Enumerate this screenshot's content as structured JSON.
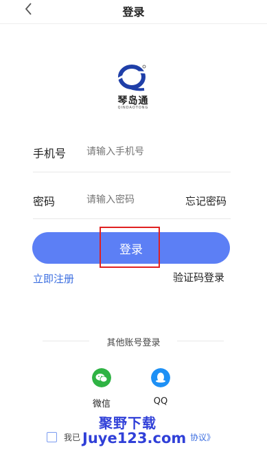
{
  "header": {
    "title": "登录",
    "back_icon": "chevron-left-icon"
  },
  "logo": {
    "name": "琴岛通",
    "subtitle": "QINDAOTONG"
  },
  "form": {
    "phone": {
      "label": "手机号",
      "placeholder": "请输入手机号"
    },
    "password": {
      "label": "密码",
      "placeholder": "请输入密码",
      "forgot_label": "忘记密码"
    }
  },
  "actions": {
    "login_label": "登录",
    "register_label": "立即注册",
    "code_login_label": "验证码登录"
  },
  "other_login": {
    "title": "其他账号登录",
    "options": [
      {
        "label": "微信",
        "icon": "wechat-icon",
        "color": "#2fb344"
      },
      {
        "label": "QQ",
        "icon": "qq-icon",
        "color": "#1e90f5"
      }
    ]
  },
  "agreement": {
    "prefix": "我已",
    "link_suffix": "协议》"
  },
  "watermark": {
    "top": "聚野下载",
    "bottom": "Juye123.com"
  },
  "colors": {
    "accent": "#5c7ff5",
    "link": "#3a6de0",
    "highlight": "#e02020"
  }
}
